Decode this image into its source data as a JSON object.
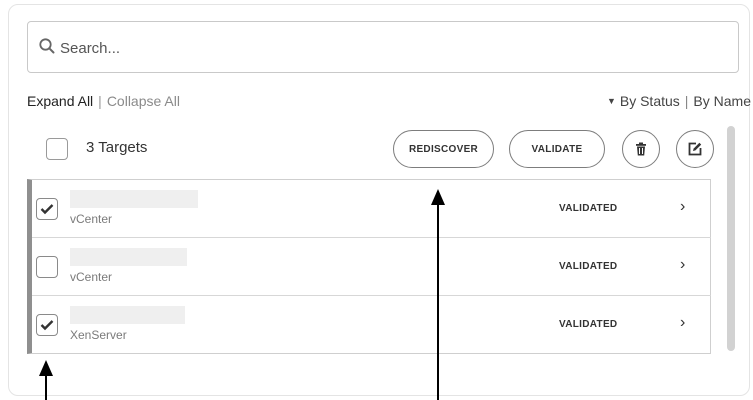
{
  "search": {
    "placeholder": "Search..."
  },
  "view_controls": {
    "expand_all": "Expand All",
    "separator": "|",
    "collapse_all": "Collapse All"
  },
  "sort": {
    "by_status": "By Status",
    "separator": "|",
    "by_name": "By Name"
  },
  "header": {
    "targets_label": "3 Targets",
    "rediscover": "REDISCOVER",
    "validate": "VALIDATE"
  },
  "targets": [
    {
      "type": "vCenter",
      "status": "VALIDATED",
      "checked": true
    },
    {
      "type": "vCenter",
      "status": "VALIDATED",
      "checked": false
    },
    {
      "type": "XenServer",
      "status": "VALIDATED",
      "checked": true
    }
  ],
  "icons": {
    "search": "search-icon",
    "trash": "trash-icon",
    "edit": "edit-icon",
    "chevron": "chevron-right-icon",
    "check": "checkmark-icon"
  },
  "colors": {
    "border": "#c9c9c9",
    "list_accent": "#8f8f8f",
    "text": "#333333",
    "muted": "#8a8a8a"
  }
}
